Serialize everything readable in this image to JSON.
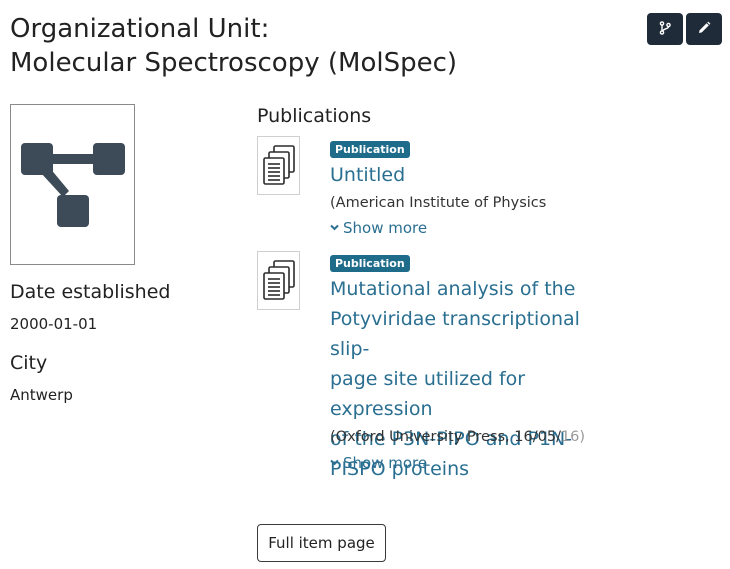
{
  "header": {
    "title_line1": "Organizational Unit:",
    "title_line2": "Molecular Spectroscopy (MolSpec)",
    "actions": [
      {
        "name": "version-button",
        "icon": "git-branch-icon"
      },
      {
        "name": "edit-button",
        "icon": "pencil-icon"
      }
    ]
  },
  "sidebar": {
    "thumbnail_icon": "org-unit-icon",
    "date_established_label": "Date established",
    "date_established_value": "2000-01-01",
    "city_label": "City",
    "city_value": "Antwerp"
  },
  "publications": {
    "heading": "Publications",
    "items": [
      {
        "badge": "Publication",
        "title": "Untitled",
        "meta": "(American Institute of Physics",
        "meta_faded": "",
        "show_more": "Show more",
        "thumbnail_icon": "documents-icon"
      },
      {
        "badge": "Publication",
        "title": "Mutational analysis of the Potyviridae transcriptional slip-page site utilized for expression of the P3N-PIPO and P1N-PISPO proteins",
        "title_lines": [
          "Mutational analysis of the",
          "Potyviridae transcriptional slip-",
          "page site utilized for expression",
          "of the P3N-PIPO and P1N-",
          "PISPO proteins"
        ],
        "meta": "(Oxford University Press, 16/05/",
        "meta_faded": "16)",
        "show_more": "Show more",
        "thumbnail_icon": "documents-icon"
      }
    ]
  },
  "footer": {
    "full_item_label": "Full item page"
  },
  "colors": {
    "accent": "#2a6f91",
    "badge": "#1f6b8a",
    "dark_button": "#1f2b38",
    "org_icon": "#3d4a57"
  }
}
